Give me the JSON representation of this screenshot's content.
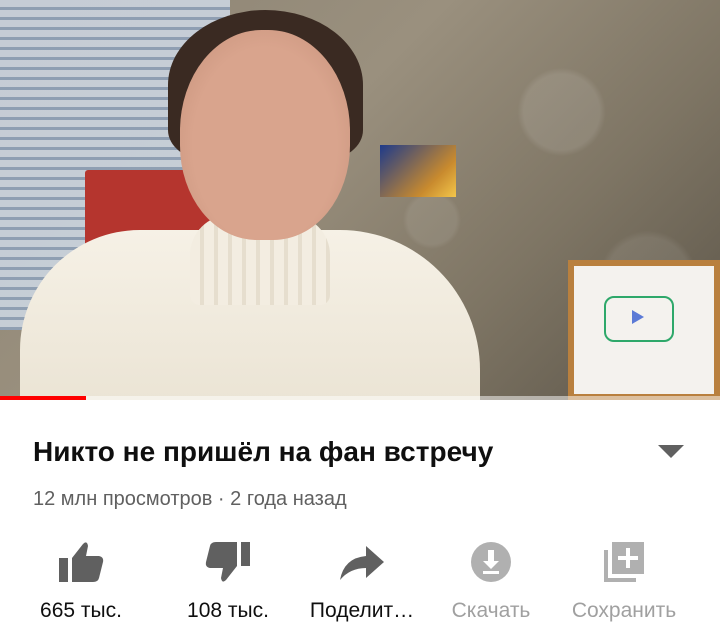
{
  "video": {
    "progress_fraction": 0.12
  },
  "title": "Никто не пришёл на фан встречу",
  "meta": {
    "views": "12 млн просмотров",
    "separator": " · ",
    "age": "2 года назад"
  },
  "actions": [
    {
      "name": "like-button",
      "icon": "thumb-up-icon",
      "label": "665 тыс.",
      "enabled": true
    },
    {
      "name": "dislike-button",
      "icon": "thumb-down-icon",
      "label": "108 тыс.",
      "enabled": true
    },
    {
      "name": "share-button",
      "icon": "share-icon",
      "label": "Поделит…",
      "enabled": true
    },
    {
      "name": "download-button",
      "icon": "download-icon",
      "label": "Скачать",
      "enabled": false
    },
    {
      "name": "save-button",
      "icon": "add-to-playlist-icon",
      "label": "Сохранить",
      "enabled": false
    }
  ],
  "colors": {
    "progress": "#ff0000",
    "icon_active": "#606060",
    "icon_disabled": "#b0b0b0"
  }
}
